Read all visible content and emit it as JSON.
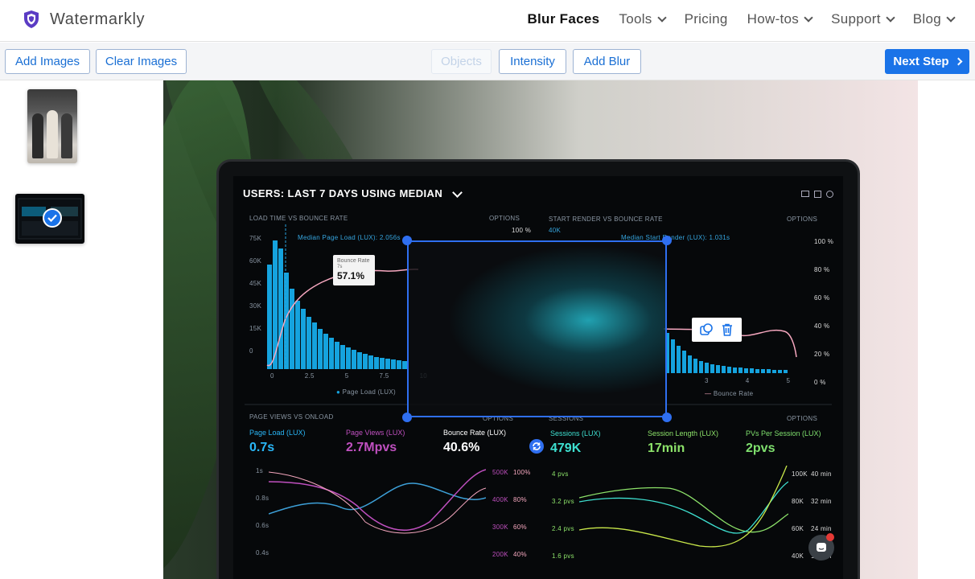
{
  "brand": {
    "name": "Watermarkly",
    "logo_color": "#5b3cc4"
  },
  "nav": {
    "items": [
      {
        "label": "Blur Faces",
        "active": true,
        "dropdown": false
      },
      {
        "label": "Tools",
        "active": false,
        "dropdown": true
      },
      {
        "label": "Pricing",
        "active": false,
        "dropdown": false
      },
      {
        "label": "How-tos",
        "active": false,
        "dropdown": true
      },
      {
        "label": "Support",
        "active": false,
        "dropdown": true
      },
      {
        "label": "Blog",
        "active": false,
        "dropdown": true
      }
    ]
  },
  "toolbar": {
    "add_images": "Add Images",
    "clear_images": "Clear Images",
    "objects": "Objects",
    "intensity": "Intensity",
    "add_blur": "Add Blur",
    "next_step": "Next Step",
    "accent": "#1a73e8"
  },
  "thumbnails": [
    {
      "name": "people-photo",
      "selected": false
    },
    {
      "name": "laptop-dashboard-photo",
      "selected": true
    }
  ],
  "photo": {
    "screen_title": "USERS: LAST 7 DAYS USING MEDIAN",
    "panel1_title": "LOAD TIME VS BOUNCE RATE",
    "panel1_options": "OPTIONS",
    "median_label": "Median Page Load (LUX): 2.056s",
    "tooltip_label": "Bounce Rate",
    "tooltip_sub": "7s",
    "tooltip_value": "57.1%",
    "panel2_title": "START RENDER VS BOUNCE RATE",
    "panel2_options": "OPTIONS",
    "panel2_median": "Median Start Render (LUX): 1.031s",
    "legend_page_load": "Page Load (LUX)",
    "legend_bounce": "Bounce Rate",
    "panel3_title": "PAGE VIEWS VS ONLOAD",
    "panel3_options": "OPTIONS",
    "panel4_title": "SESSIONS",
    "panel4_options": "OPTIONS",
    "y_ticks_left": [
      "75K",
      "60K",
      "45K",
      "30K",
      "15K",
      "0"
    ],
    "x_ticks_left": [
      "0",
      "2.5",
      "5",
      "7.5",
      "10"
    ],
    "y_ticks_right": [
      "100 %",
      "80 %",
      "60 %",
      "40 %",
      "20 %",
      "0 %"
    ],
    "top_pct": "100 %",
    "top_40k": "40K",
    "x_ticks_right": [
      "3",
      "4",
      "5"
    ],
    "metrics": [
      {
        "label": "Page Load (LUX)",
        "value": "0.7s",
        "color": "#29b6f6"
      },
      {
        "label": "Page Views (LUX)",
        "value": "2.7Mpvs",
        "color": "#c050c0"
      },
      {
        "label": "Bounce Rate (LUX)",
        "value": "40.6%",
        "color": "#ffffff"
      },
      {
        "label": "Sessions (LUX)",
        "value": "479K",
        "color": "#3ee0d0"
      },
      {
        "label": "Session Length (LUX)",
        "value": "17min",
        "color": "#8de36a"
      },
      {
        "label": "PVs Per Session (LUX)",
        "value": "2pvs",
        "color": "#7fe06e"
      }
    ],
    "lower_left_y": [
      "1s",
      "0.8s",
      "0.6s",
      "0.4s"
    ],
    "lower_mid_y1": [
      "500K",
      "400K",
      "300K",
      "200K"
    ],
    "lower_mid_y2": [
      "100%",
      "80%",
      "60%",
      "40%"
    ],
    "lower_right_y1": [
      "4 pvs",
      "3.2 pvs",
      "2.4 pvs",
      "1.6 pvs"
    ],
    "lower_right_y2": [
      "100K",
      "80K",
      "60K",
      "40K"
    ],
    "lower_right_y3": [
      "40 min",
      "32 min",
      "24 min",
      "16 min"
    ]
  }
}
